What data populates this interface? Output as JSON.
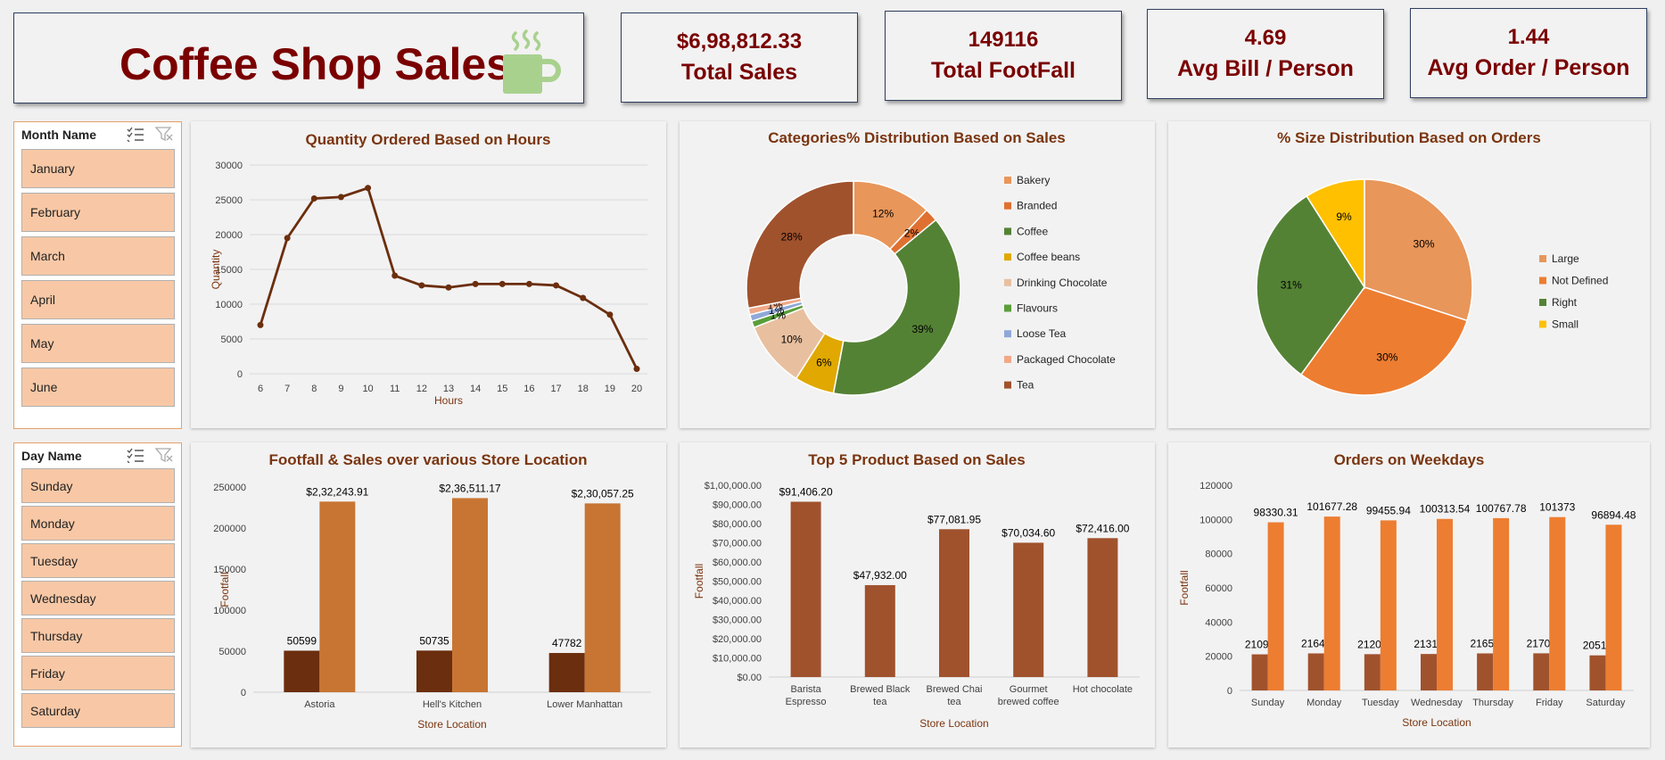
{
  "header": {
    "title": "Coffee Shop Sales"
  },
  "kpis": [
    {
      "value": "$6,98,812.33",
      "label": "Total Sales"
    },
    {
      "value": "149116",
      "label": "Total FootFall"
    },
    {
      "value": "4.69",
      "label": "Avg Bill / Person"
    },
    {
      "value": "1.44",
      "label": "Avg Order / Person"
    }
  ],
  "slicers": {
    "month": {
      "title": "Month Name",
      "items": [
        "January",
        "February",
        "March",
        "April",
        "May",
        "June"
      ]
    },
    "day": {
      "title": "Day Name",
      "items": [
        "Sunday",
        "Monday",
        "Tuesday",
        "Wednesday",
        "Thursday",
        "Friday",
        "Saturday"
      ]
    }
  },
  "colors": {
    "title": "#7a0000",
    "slicer_item": "#f8c8a6",
    "dark_brown": "#6b2e0e",
    "brown": "#a0522d",
    "orange": "#ed7d31",
    "copper": "#c87533"
  },
  "chart_data": [
    {
      "type": "line",
      "title": "Quantity Ordered Based on Hours",
      "xlabel": "Hours",
      "ylabel": "Quantity",
      "x": [
        6,
        7,
        8,
        9,
        10,
        11,
        12,
        13,
        14,
        15,
        16,
        17,
        18,
        19,
        20
      ],
      "values": [
        7000,
        19500,
        25200,
        25400,
        26700,
        14100,
        12700,
        12400,
        12900,
        12900,
        12900,
        12700,
        10900,
        8500,
        700
      ],
      "ylim": [
        0,
        30000
      ],
      "yticks": [
        0,
        5000,
        10000,
        15000,
        20000,
        25000,
        30000
      ],
      "grid": true
    },
    {
      "type": "pie",
      "donut": true,
      "title": "Categories%  Distribution Based on Sales",
      "legend_position": "right",
      "slices": [
        {
          "name": "Bakery",
          "value": 12,
          "label": "12%",
          "color": "#e8965a"
        },
        {
          "name": "Branded",
          "value": 2,
          "label": "2%",
          "color": "#e07030"
        },
        {
          "name": "Coffee",
          "value": 39,
          "label": "39%",
          "color": "#548235"
        },
        {
          "name": "Coffee beans",
          "value": 6,
          "label": "6%",
          "color": "#e0a800"
        },
        {
          "name": "Drinking Chocolate",
          "value": 10,
          "label": "10%",
          "color": "#e8c0a0"
        },
        {
          "name": "Flavours",
          "value": 1,
          "label": "1%",
          "color": "#5a9e3a"
        },
        {
          "name": "Loose Tea",
          "value": 1,
          "label": "1%",
          "color": "#8fa8d8"
        },
        {
          "name": "Packaged Chocolate",
          "value": 1,
          "label": "1%",
          "color": "#f0a888"
        },
        {
          "name": "Tea",
          "value": 28,
          "label": "28%",
          "color": "#a0522d"
        }
      ]
    },
    {
      "type": "pie",
      "title": "% Size Distribution Based on Orders",
      "legend_position": "right",
      "slices": [
        {
          "name": "Large",
          "value": 30,
          "label": "30%",
          "color": "#e8965a"
        },
        {
          "name": "Not Defined",
          "value": 30,
          "label": "30%",
          "color": "#ed7d31"
        },
        {
          "name": "Right",
          "value": 31,
          "label": "31%",
          "color": "#548235"
        },
        {
          "name": "Small",
          "value": 9,
          "label": "9%",
          "color": "#ffc000"
        }
      ]
    },
    {
      "type": "bar",
      "title": "Footfall & Sales over various Store Location",
      "xlabel": "Store Location",
      "ylabel": "Footfall",
      "categories": [
        "Astoria",
        "Hell's Kitchen",
        "Lower Manhattan"
      ],
      "ylim": [
        0,
        250000
      ],
      "yticks": [
        0,
        50000,
        100000,
        150000,
        200000,
        250000
      ],
      "series": [
        {
          "values": [
            50599,
            50735,
            47782
          ],
          "labels": [
            "50599",
            "50735",
            "47782"
          ],
          "color": "#6b2e0e"
        },
        {
          "values": [
            232243.91,
            236511.17,
            230057.25
          ],
          "labels": [
            "$2,32,243.91",
            "$2,36,511.17",
            "$2,30,057.25"
          ],
          "color": "#c87533"
        }
      ]
    },
    {
      "type": "bar",
      "title": "Top 5 Product Based on Sales",
      "xlabel": "Store Location",
      "ylabel": "Footfall",
      "categories": [
        [
          "Barista",
          "Espresso"
        ],
        [
          "Brewed Black",
          "tea"
        ],
        [
          "Brewed Chai",
          "tea"
        ],
        [
          "Gourmet",
          "brewed coffee"
        ],
        [
          "Hot chocolate"
        ]
      ],
      "ylim": [
        0,
        100000
      ],
      "yticks": [
        "$0.00",
        "$10,000.00",
        "$20,000.00",
        "$30,000.00",
        "$40,000.00",
        "$50,000.00",
        "$60,000.00",
        "$70,000.00",
        "$80,000.00",
        "$90,000.00",
        "$1,00,000.00"
      ],
      "series": [
        {
          "values": [
            91406.2,
            47932.0,
            77081.95,
            70034.6,
            72416.0
          ],
          "labels": [
            "$91,406.20",
            "$47,932.00",
            "$77,081.95",
            "$70,034.60",
            "$72,416.00"
          ],
          "color": "#a0522d"
        }
      ]
    },
    {
      "type": "bar",
      "title": "Orders on Weekdays",
      "xlabel": "Store Location",
      "ylabel": "Footfall",
      "categories": [
        "Sunday",
        "Monday",
        "Tuesday",
        "Wednesday",
        "Thursday",
        "Friday",
        "Saturday"
      ],
      "ylim": [
        0,
        120000
      ],
      "yticks": [
        0,
        20000,
        40000,
        60000,
        80000,
        100000,
        120000
      ],
      "series": [
        {
          "values": [
            21096,
            21643,
            21202,
            21310,
            21654,
            21701,
            20510
          ],
          "labels": [
            "21096",
            "21643",
            "21202",
            "21310",
            "21654",
            "21701",
            "20510"
          ],
          "color": "#a0522d"
        },
        {
          "values": [
            98330.31,
            101677.28,
            99455.94,
            100313.54,
            100767.78,
            101373,
            96894.48
          ],
          "labels": [
            "98330.31",
            "101677.28",
            "99455.94",
            "100313.54",
            "100767.78",
            "101373",
            "96894.48"
          ],
          "color": "#ed7d31"
        }
      ]
    }
  ]
}
